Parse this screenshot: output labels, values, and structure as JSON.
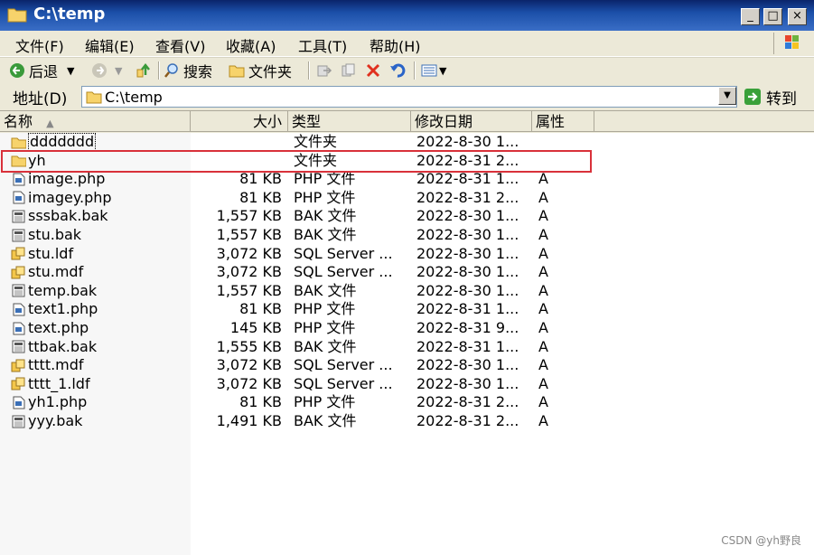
{
  "window": {
    "title": "C:\\temp",
    "controls": {
      "minimize": "_",
      "maximize": "□",
      "close": "×"
    }
  },
  "menu": [
    "文件(F)",
    "编辑(E)",
    "查看(V)",
    "收藏(A)",
    "工具(T)",
    "帮助(H)"
  ],
  "toolbar": {
    "back_label": "后退",
    "search_label": "搜索",
    "folders_label": "文件夹"
  },
  "address": {
    "label": "地址(D)",
    "value": "C:\\temp",
    "go_label": "转到"
  },
  "columns": {
    "name": "名称",
    "size": "大小",
    "type": "类型",
    "modified": "修改日期",
    "attributes": "属性"
  },
  "files": [
    {
      "name": "ddddddd",
      "size": "",
      "type": "文件夹",
      "modified": "2022-8-30 1...",
      "attr": "",
      "icon": "folder-icon"
    },
    {
      "name": "yh",
      "size": "",
      "type": "文件夹",
      "modified": "2022-8-31 2...",
      "attr": "",
      "icon": "folder-icon"
    },
    {
      "name": "image.php",
      "size": "81 KB",
      "type": "PHP 文件",
      "modified": "2022-8-31 1...",
      "attr": "A",
      "icon": "php-file-icon"
    },
    {
      "name": "imagey.php",
      "size": "81 KB",
      "type": "PHP 文件",
      "modified": "2022-8-31 2...",
      "attr": "A",
      "icon": "php-file-icon"
    },
    {
      "name": "sssbak.bak",
      "size": "1,557 KB",
      "type": "BAK 文件",
      "modified": "2022-8-30 1...",
      "attr": "A",
      "icon": "bak-file-icon"
    },
    {
      "name": "stu.bak",
      "size": "1,557 KB",
      "type": "BAK 文件",
      "modified": "2022-8-30 1...",
      "attr": "A",
      "icon": "bak-file-icon"
    },
    {
      "name": "stu.ldf",
      "size": "3,072 KB",
      "type": "SQL Server ...",
      "modified": "2022-8-30 1...",
      "attr": "A",
      "icon": "sql-file-icon"
    },
    {
      "name": "stu.mdf",
      "size": "3,072 KB",
      "type": "SQL Server ...",
      "modified": "2022-8-30 1...",
      "attr": "A",
      "icon": "sql-file-icon"
    },
    {
      "name": "temp.bak",
      "size": "1,557 KB",
      "type": "BAK 文件",
      "modified": "2022-8-30 1...",
      "attr": "A",
      "icon": "bak-file-icon"
    },
    {
      "name": "text1.php",
      "size": "81 KB",
      "type": "PHP 文件",
      "modified": "2022-8-31 1...",
      "attr": "A",
      "icon": "php-file-icon"
    },
    {
      "name": "text.php",
      "size": "145 KB",
      "type": "PHP 文件",
      "modified": "2022-8-31 9...",
      "attr": "A",
      "icon": "php-file-icon"
    },
    {
      "name": "ttbak.bak",
      "size": "1,555 KB",
      "type": "BAK 文件",
      "modified": "2022-8-31 1...",
      "attr": "A",
      "icon": "bak-file-icon"
    },
    {
      "name": "tttt.mdf",
      "size": "3,072 KB",
      "type": "SQL Server ...",
      "modified": "2022-8-30 1...",
      "attr": "A",
      "icon": "sql-file-icon"
    },
    {
      "name": "tttt_1.ldf",
      "size": "3,072 KB",
      "type": "SQL Server ...",
      "modified": "2022-8-30 1...",
      "attr": "A",
      "icon": "sql-file-icon"
    },
    {
      "name": "yh1.php",
      "size": "81 KB",
      "type": "PHP 文件",
      "modified": "2022-8-31 2...",
      "attr": "A",
      "icon": "php-file-icon"
    },
    {
      "name": "yyy.bak",
      "size": "1,491 KB",
      "type": "BAK 文件",
      "modified": "2022-8-31 2...",
      "attr": "A",
      "icon": "bak-file-icon"
    }
  ],
  "highlighted_row": "yh",
  "watermark": "CSDN @yh野良",
  "colors": {
    "title_bar": "#1b4fa8",
    "highlight_border": "#d9313a",
    "window_face": "#ECE9D8"
  }
}
